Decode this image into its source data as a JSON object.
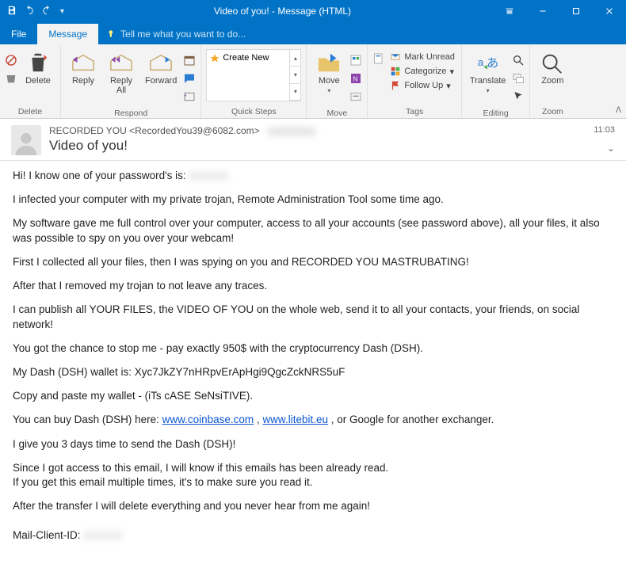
{
  "window": {
    "title": "Video of you! - Message (HTML)"
  },
  "tabs": {
    "file": "File",
    "message": "Message",
    "tellme": "Tell me what you want to do..."
  },
  "ribbon": {
    "delete": {
      "label": "Delete",
      "group": "Delete"
    },
    "respond": {
      "reply": "Reply",
      "replyall": "Reply\nAll",
      "forward": "Forward",
      "group": "Respond"
    },
    "quicksteps": {
      "create": "Create New",
      "group": "Quick Steps"
    },
    "move": {
      "move": "Move",
      "group": "Move"
    },
    "tags": {
      "unread": "Mark Unread",
      "categorize": "Categorize",
      "followup": "Follow Up",
      "group": "Tags"
    },
    "editing": {
      "translate": "Translate",
      "group": "Editing"
    },
    "zoom": {
      "zoom": "Zoom",
      "group": "Zoom"
    }
  },
  "email": {
    "from": "RECORDED YOU <RecordedYou39@6082.com>",
    "subject": "Video of you!",
    "time": "11:03",
    "body": {
      "p1a": "Hi! I know one of your password's is: ",
      "p2": "I infected your computer with my private trojan, Remote Administration Tool some time ago.",
      "p3": "My software gave me full control over your computer, access to all your accounts (see password above), all your files, it also was possible to spy on you over your webcam!",
      "p4": "First I collected all your files, then I was spying on you and RECORDED YOU MASTRUBATING!",
      "p5": "After that I removed my trojan to not leave any traces.",
      "p6": "I can publish all YOUR FILES, the VIDEO OF YOU on the whole web, send it to all your contacts, your friends, on social network!",
      "p7": "You got the chance to stop me - pay exactly 950$ with the cryptocurrency Dash (DSH).",
      "p8": "My Dash (DSH) wallet is: Xyc7JkZY7nHRpvErApHgi9QgcZckNRS5uF",
      "p9": "Copy and paste my wallet - (iTs cASE SeNsiTIVE).",
      "p10a": "You can buy Dash (DSH) here: ",
      "p10link1": "www.coinbase.com",
      "p10b": " , ",
      "p10link2": "www.litebit.eu",
      "p10c": " , or Google for another exchanger.",
      "p11": "I give you 3 days time to send the Dash (DSH)!",
      "p12": "Since I got access to this email, I will know if this emails has been already read.",
      "p13": "If you get this email multiple times, it's to make sure you read it.",
      "p14": "After the transfer I will delete everything and you never hear from me again!",
      "p15": "Mail-Client-ID: "
    }
  }
}
